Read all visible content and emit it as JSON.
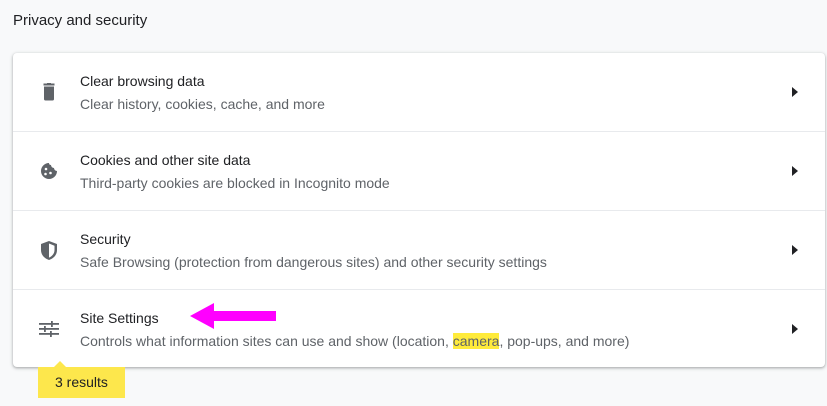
{
  "section": {
    "title": "Privacy and security"
  },
  "rows": [
    {
      "title": "Clear browsing data",
      "subtitle": "Clear history, cookies, cache, and more",
      "icon": "trash-icon"
    },
    {
      "title": "Cookies and other site data",
      "subtitle": "Third-party cookies are blocked in Incognito mode",
      "icon": "cookie-icon"
    },
    {
      "title": "Security",
      "subtitle": "Safe Browsing (protection from dangerous sites) and other security settings",
      "icon": "shield-icon"
    },
    {
      "title": "Site Settings",
      "subtitle_before": "Controls what information sites can use and show (location, ",
      "subtitle_highlight": "camera",
      "subtitle_after": ", pop-ups, and more)",
      "icon": "sliders-icon"
    }
  ],
  "search_results": {
    "label": "3 results"
  },
  "colors": {
    "highlight": "#ffeb3b",
    "annotation_arrow": "#ff00ff",
    "results_bubble": "#fde74c"
  }
}
